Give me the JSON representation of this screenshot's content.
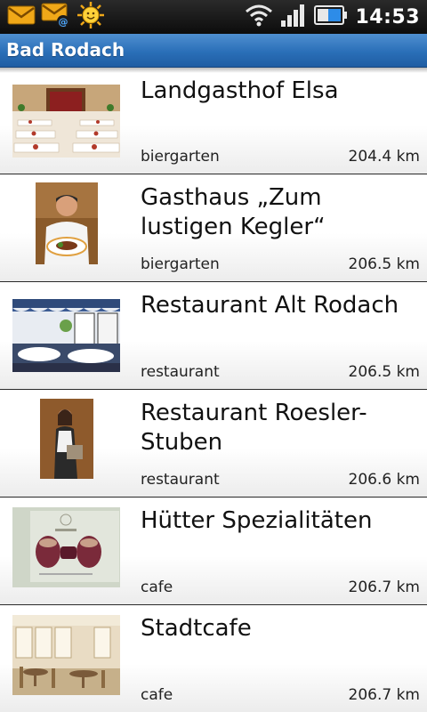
{
  "status_bar": {
    "time": "14:53",
    "icons": [
      "email-icon",
      "email-at-icon",
      "smiley-sun-icon",
      "wifi-icon",
      "signal-icon",
      "battery-icon"
    ]
  },
  "header": {
    "title": "Bad Rodach"
  },
  "colors": {
    "titlebar": "#2a6fb8",
    "statusbar": "#111111",
    "divider": "#2a2a2a"
  },
  "list": {
    "items": [
      {
        "name": "Landgasthof Elsa",
        "category": "biergarten",
        "distance": "204.4 km",
        "thumbnail": "banquet-hall-photo"
      },
      {
        "name": "Gasthaus „Zum lustigen Kegler“",
        "category": "biergarten",
        "distance": "206.5 km",
        "thumbnail": "chef-with-plate-photo"
      },
      {
        "name": "Restaurant Alt Rodach",
        "category": "restaurant",
        "distance": "206.5 km",
        "thumbnail": "dining-room-photo"
      },
      {
        "name": "Restaurant Roesler-Stuben",
        "category": "restaurant",
        "distance": "206.6 km",
        "thumbnail": "waitress-photo"
      },
      {
        "name": "Hütter Spezialitäten",
        "category": "cafe",
        "distance": "206.7 km",
        "thumbnail": "sausage-product-photo"
      },
      {
        "name": "Stadtcafe",
        "category": "cafe",
        "distance": "206.7 km",
        "thumbnail": "cafe-interior-photo"
      }
    ]
  }
}
